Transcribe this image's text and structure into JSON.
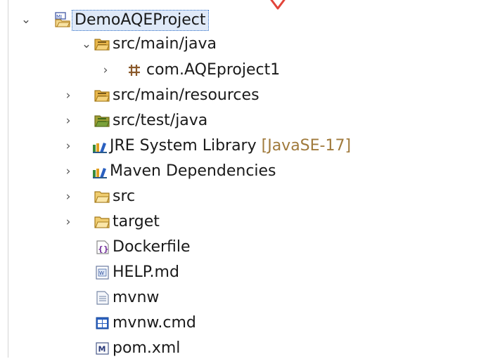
{
  "tree": {
    "root": {
      "label": "DemoAQEProject",
      "icon": "maven-project-icon",
      "expanded": true
    },
    "items": [
      {
        "label": "src/main/java",
        "icon": "source-folder-icon",
        "expanded": true
      },
      {
        "label": "com.AQEproject1",
        "icon": "package-icon",
        "expanded": false
      },
      {
        "label": "src/main/resources",
        "icon": "source-folder-icon",
        "expanded": false
      },
      {
        "label": "src/test/java",
        "icon": "test-source-folder-icon",
        "expanded": false
      },
      {
        "label": "JRE System Library",
        "decoration": "[JavaSE-17]",
        "icon": "library-icon",
        "expanded": false
      },
      {
        "label": "Maven Dependencies",
        "icon": "library-icon",
        "expanded": false
      },
      {
        "label": "src",
        "icon": "folder-icon",
        "expanded": false
      },
      {
        "label": "target",
        "icon": "folder-icon",
        "expanded": false
      },
      {
        "label": "Dockerfile",
        "icon": "dockerfile-icon"
      },
      {
        "label": "HELP.md",
        "icon": "markdown-file-icon"
      },
      {
        "label": "mvnw",
        "icon": "text-file-icon"
      },
      {
        "label": "mvnw.cmd",
        "icon": "cmd-file-icon"
      },
      {
        "label": "pom.xml",
        "icon": "maven-pom-icon"
      }
    ]
  },
  "colors": {
    "selection_border": "#2b6cc4",
    "selection_bg": "#dfe9f8",
    "decoration": "#a07a3c",
    "marker": "#e2443a"
  }
}
